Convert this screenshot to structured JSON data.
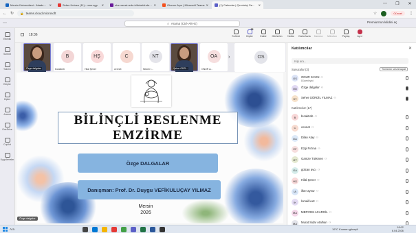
{
  "browser": {
    "tabs": [
      {
        "title": "Mersin Üniversitesi - Akademik",
        "color": "#1565c0",
        "active": false
      },
      {
        "title": "Seker Kutusu (11) - mnu.sgp",
        "color": "#e53935",
        "active": false
      },
      {
        "title": "obs.mersin.edu.tr/ticket/index.ro",
        "color": "#6a1b9a",
        "active": false
      },
      {
        "title": "Oturum Açın | Microsoft Teams",
        "color": "#f4511e",
        "active": false
      },
      {
        "title": "(1) Calendar | Çevrimiçi Se...",
        "color": "#5b5fc7",
        "active": true
      }
    ],
    "url": "teams.cloud.microsoft",
    "update_label": "Güncel",
    "window_buttons": [
      "—",
      "❐",
      "✕"
    ]
  },
  "teams": {
    "search_placeholder": "Arama (Ctrl+Alt+E)",
    "premium_label": "Premium'un kilidini aç"
  },
  "rail": [
    {
      "label": "Etkinlik"
    },
    {
      "label": "Sohbet"
    },
    {
      "label": "Takvim"
    },
    {
      "label": "Ekipler"
    },
    {
      "label": "Kişiler"
    },
    {
      "label": "Arama"
    },
    {
      "label": "OneDrive"
    },
    {
      "label": "Copilot"
    },
    {
      "label": "Uygulamalar"
    }
  ],
  "meeting": {
    "elapsed": "18:36",
    "tools": [
      {
        "label": "Sohbet",
        "badge": "",
        "state": "normal"
      },
      {
        "label": "Kişiler",
        "badge": "26",
        "state": "active"
      },
      {
        "label": "Kaldır",
        "badge": "",
        "state": "normal"
      },
      {
        "label": "Görünüm",
        "badge": "",
        "state": "normal"
      },
      {
        "label": "Notlar",
        "badge": "",
        "state": "normal"
      },
      {
        "label": "Daha fazla",
        "badge": "",
        "state": "normal"
      },
      {
        "label": "Kamera",
        "badge": "",
        "state": "dim"
      },
      {
        "label": "Mikrofon",
        "badge": "",
        "state": "dim"
      },
      {
        "label": "Paylaş",
        "badge": "",
        "state": "normal"
      },
      {
        "label": "Ayrıl",
        "badge": "",
        "state": "leave"
      }
    ]
  },
  "strip": {
    "tiles": [
      {
        "initials": "",
        "name": "Özge dalgalar",
        "video": true,
        "bg": ""
      },
      {
        "initials": "B",
        "name": "bıcaktınb",
        "video": false,
        "bg": "#f3d6d6"
      },
      {
        "initials": "HŞ",
        "name": "Hilal Şener",
        "video": false,
        "bg": "#f9d9d9"
      },
      {
        "initials": "C",
        "name": "cennet",
        "video": false,
        "bg": "#f6d8d0"
      },
      {
        "initials": "NT",
        "name": "Nesrin t...",
        "video": false,
        "bg": "#e4e4ea"
      },
      {
        "initials": "",
        "name": "Şeher GÜR...",
        "video": true,
        "bg": ""
      },
      {
        "initials": "OA",
        "name": "ONUR A...",
        "video": false,
        "bg": "#f6dede"
      }
    ],
    "arrow": "›",
    "overflow_initials": "OS"
  },
  "slide": {
    "title_line1": "BİLİNÇLİ BESLENME",
    "title_line2": "EMZİRME",
    "presenter": "Özge DALGALAR",
    "advisor": "Danışman: Prof. Dr. Duygu VEFİKULUÇAY YILMAZ",
    "city": "Mersin",
    "year": "2026",
    "presenter_tag": "Özge dalgalar"
  },
  "panel": {
    "title": "Katılımcılar",
    "search_placeholder": "Kişi ara...",
    "mute_all": "Tümünün sesini kapat",
    "organizers_label": "Sunucular (3)",
    "attendees_label": "Katılımcılar (17)",
    "organizers": [
      {
        "initials": "OS",
        "name": "ONUR SAYIN",
        "role": "Düzenleyici",
        "color": "#dbe3f6",
        "mic": false
      },
      {
        "initials": "ÖD",
        "name": "Özge dalgalar",
        "role": "",
        "color": "#e1d9f3",
        "mic": true
      },
      {
        "initials": "SY",
        "name": "Seher GÜRDİL YILMAZ",
        "role": "",
        "color": "#f6e1c9",
        "mic": true
      }
    ],
    "attendees": [
      {
        "initials": "B",
        "name": "bıcaktınb",
        "color": "#f8d7d7"
      },
      {
        "initials": "C",
        "name": "cennet",
        "color": "#f7dbd0"
      },
      {
        "initials": "DA",
        "name": "Dilan Atay",
        "color": "#dce9f8"
      },
      {
        "initials": "EF",
        "name": "Ezgi Fırtına",
        "color": "#f6dede"
      },
      {
        "initials": "GT",
        "name": "Gamze Türkmen",
        "color": "#e3e8cf"
      },
      {
        "initials": "GA",
        "name": "gülcan avcı",
        "color": "#d5ecea"
      },
      {
        "initials": "HŞ",
        "name": "Hilal Şener",
        "color": "#f8d9d9"
      },
      {
        "initials": "İA",
        "name": "ilker aynur",
        "color": "#d8e6f8"
      },
      {
        "initials": "İK",
        "name": "İsmail kurt",
        "color": "#e4dcf4"
      },
      {
        "initials": "MA",
        "name": "MERYEM ACARGİL",
        "color": "#f3d6e8"
      },
      {
        "initials": "MA",
        "name": "Murat Sidar Atalhan",
        "color": "#e3e4ea"
      }
    ]
  },
  "taskbar": {
    "search_label": "Ara",
    "weather": "19°C  Kısmen güneşli",
    "time": "18:02",
    "date": "6.04.2026",
    "app_colors": [
      "#444",
      "#0078d4",
      "#f4b400",
      "#e53935",
      "#43a047",
      "#5b5fc7",
      "#217346",
      "#2b579a",
      "#333"
    ]
  }
}
